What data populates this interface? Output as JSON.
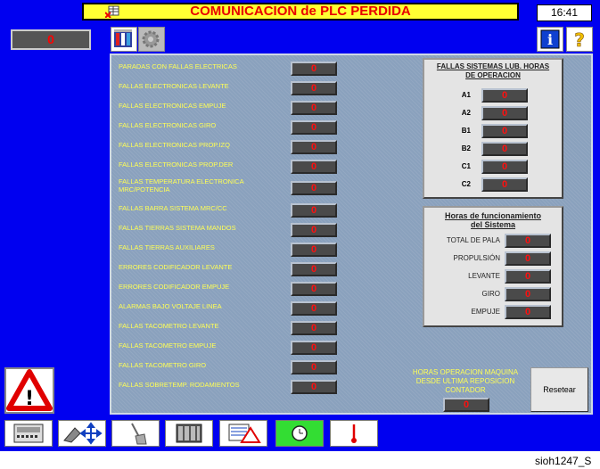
{
  "header": {
    "title": "COMUNICACION de PLC PERDIDA",
    "time": "16:41"
  },
  "alarm_counter": "0",
  "left_list": [
    {
      "label": "PARADAS CON FALLAS ELECTRICAS",
      "value": "0"
    },
    {
      "label": "FALLAS ELECTRONICAS LEVANTE",
      "value": "0"
    },
    {
      "label": "FALLAS ELECTRONICAS EMPUJE",
      "value": "0"
    },
    {
      "label": "FALLAS ELECTRONICAS GIRO",
      "value": "0"
    },
    {
      "label": "FALLAS ELECTRONICAS PROP.IZQ",
      "value": "0"
    },
    {
      "label": "FALLAS ELECTRONICAS PROP.DER",
      "value": "0"
    },
    {
      "label": "FALLAS TEMPERATURA ELECTRONICA\nMRC/POTENCIA",
      "value": "0"
    },
    {
      "label": "FALLAS BARRA SISTEMA MRC/CC",
      "value": "0"
    },
    {
      "label": "FALLAS TIERRAS SISTEMA MANDOS",
      "value": "0"
    },
    {
      "label": "FALLAS TIERRAS AUXILIARES",
      "value": "0"
    },
    {
      "label": "ERRORES CODIFICADOR LEVANTE",
      "value": "0"
    },
    {
      "label": "ERRORES CODIFICADOR EMPUJE",
      "value": "0"
    },
    {
      "label": "ALARMAS BAJO VOLTAJE LINEA",
      "value": "0"
    },
    {
      "label": "FALLAS TACOMETRO LEVANTE",
      "value": "0"
    },
    {
      "label": "FALLAS TACOMETRO EMPUJE",
      "value": "0"
    },
    {
      "label": "FALLAS TACOMETRO GIRO",
      "value": "0"
    },
    {
      "label": "FALLAS SOBRETEMP. RODAMIENTOS",
      "value": "0"
    }
  ],
  "lub_box": {
    "title": "FALLAS SISTEMAS LUB. HORAS\nDE OPERACION",
    "rows": [
      {
        "label": "A1",
        "value": "0"
      },
      {
        "label": "A2",
        "value": "0"
      },
      {
        "label": "B1",
        "value": "0"
      },
      {
        "label": "B2",
        "value": "0"
      },
      {
        "label": "C1",
        "value": "0"
      },
      {
        "label": "C2",
        "value": "0"
      }
    ]
  },
  "hours_box": {
    "title": "Horas de funcionamiento\ndel Sistema",
    "rows": [
      {
        "label": "TOTAL DE PALA",
        "value": "0"
      },
      {
        "label": "PROPULSIÓN",
        "value": "0"
      },
      {
        "label": "LEVANTE",
        "value": "0"
      },
      {
        "label": "GIRO",
        "value": "0"
      },
      {
        "label": "EMPUJE",
        "value": "0"
      }
    ]
  },
  "machine_hours": {
    "label": "HORAS OPERACION MAQUINA\nDESDE ULTIMA REPOSICION\nCONTADOR",
    "value": "0"
  },
  "reset_label": "Resetear",
  "footer": "sioh1247_S",
  "colors": {
    "background": "#0000f0",
    "title_bg": "#ffff33",
    "title_text": "#e80000",
    "label_text": "#ffff55",
    "value_text": "#ff1010"
  }
}
